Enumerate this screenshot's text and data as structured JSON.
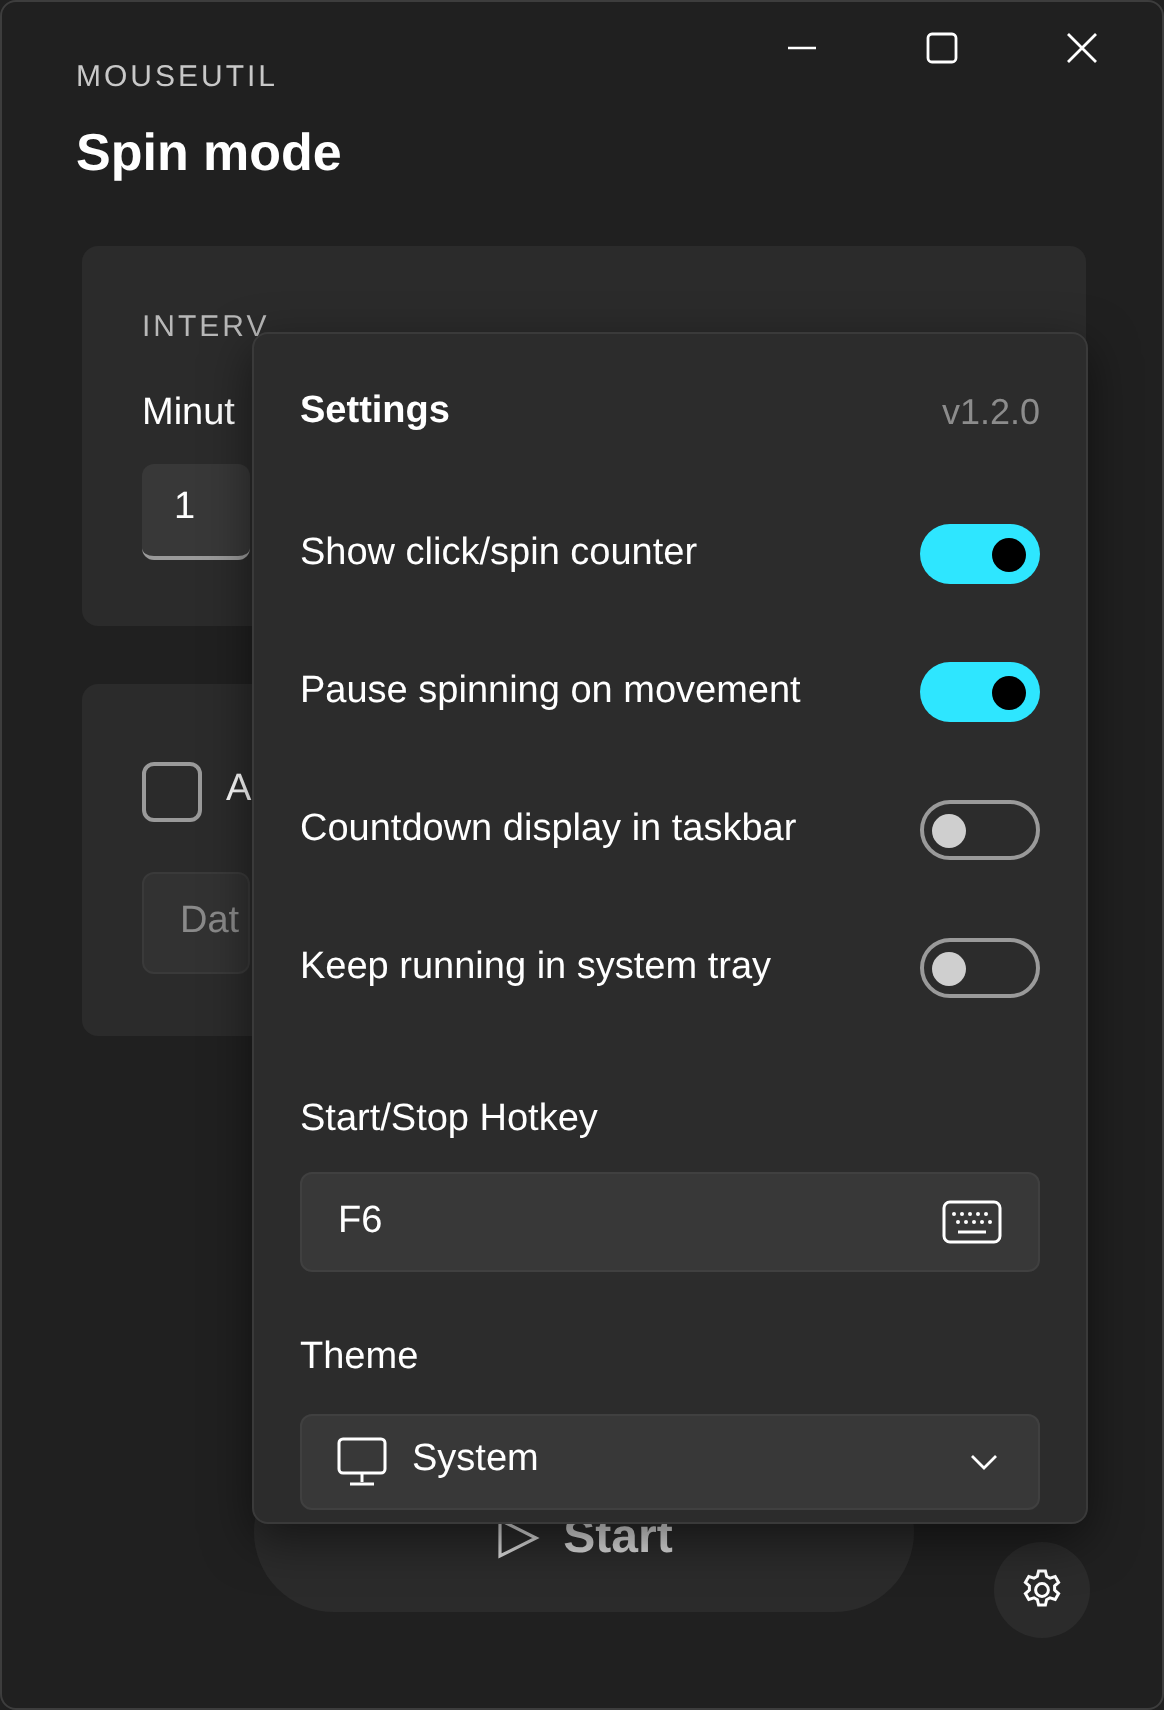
{
  "app": {
    "name": "MOUSEUTIL",
    "title": "Spin mode"
  },
  "interval_card": {
    "heading": "INTERV",
    "field_label": "Minut",
    "value": "1"
  },
  "schedule_card": {
    "checkbox": {
      "label": "A",
      "checked": false
    },
    "date_field": {
      "placeholder": "Dat"
    }
  },
  "start_button": {
    "label": "Start"
  },
  "settings": {
    "title": "Settings",
    "version": "v1.2.0",
    "toggles": [
      {
        "label": "Show click/spin counter",
        "on": true
      },
      {
        "label": "Pause spinning on movement",
        "on": true
      },
      {
        "label": "Countdown display in taskbar",
        "on": false
      },
      {
        "label": "Keep running in system tray",
        "on": false
      }
    ],
    "hotkey": {
      "label": "Start/Stop Hotkey",
      "value": "F6"
    },
    "theme": {
      "label": "Theme",
      "value": "System"
    }
  }
}
